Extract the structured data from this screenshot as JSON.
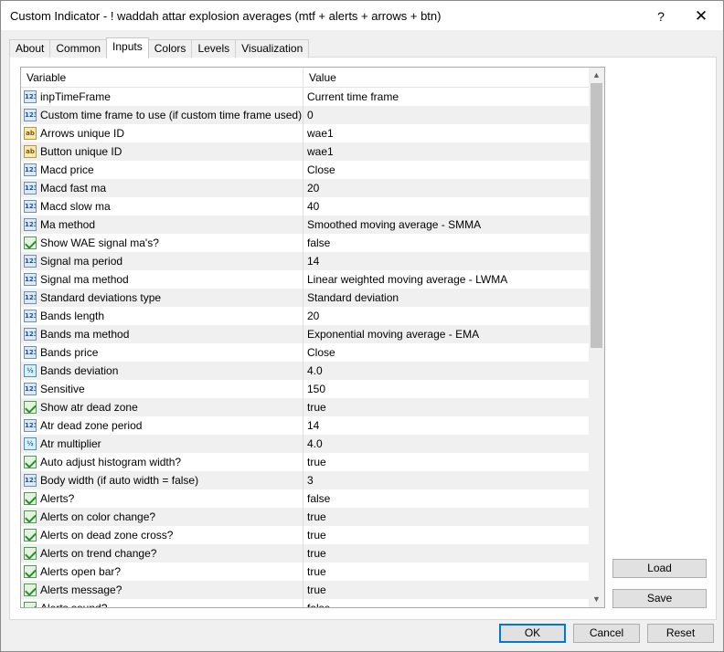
{
  "window": {
    "title": "Custom Indicator - ! waddah attar explosion averages (mtf + alerts + arrows + btn)",
    "help_label": "?",
    "close_label": "✕"
  },
  "tabs": [
    {
      "label": "About",
      "active": false
    },
    {
      "label": "Common",
      "active": false
    },
    {
      "label": "Inputs",
      "active": true
    },
    {
      "label": "Colors",
      "active": false
    },
    {
      "label": "Levels",
      "active": false
    },
    {
      "label": "Visualization",
      "active": false
    }
  ],
  "grid": {
    "columns": {
      "variable": "Variable",
      "value": "Value"
    },
    "rows": [
      {
        "type": "int",
        "icon": "123",
        "variable": "inpTimeFrame",
        "value": "Current time frame"
      },
      {
        "type": "int",
        "icon": "123",
        "variable": "Custom time frame to use (if custom time frame used)",
        "value": "0"
      },
      {
        "type": "str",
        "icon": "ab",
        "variable": "Arrows unique ID",
        "value": "wae1"
      },
      {
        "type": "str",
        "icon": "ab",
        "variable": "Button unique ID",
        "value": "wae1"
      },
      {
        "type": "int",
        "icon": "123",
        "variable": "Macd price",
        "value": "Close"
      },
      {
        "type": "int",
        "icon": "123",
        "variable": "Macd fast ma",
        "value": "20"
      },
      {
        "type": "int",
        "icon": "123",
        "variable": "Macd slow ma",
        "value": "40"
      },
      {
        "type": "int",
        "icon": "123",
        "variable": "Ma method",
        "value": "Smoothed moving average - SMMA"
      },
      {
        "type": "bool",
        "icon": "",
        "variable": "Show WAE signal ma's?",
        "value": "false"
      },
      {
        "type": "int",
        "icon": "123",
        "variable": "Signal ma period",
        "value": "14"
      },
      {
        "type": "int",
        "icon": "123",
        "variable": "Signal ma method",
        "value": "Linear weighted moving average - LWMA"
      },
      {
        "type": "int",
        "icon": "123",
        "variable": "Standard deviations type",
        "value": "Standard deviation"
      },
      {
        "type": "int",
        "icon": "123",
        "variable": "Bands length",
        "value": "20"
      },
      {
        "type": "int",
        "icon": "123",
        "variable": "Bands ma method",
        "value": "Exponential moving average - EMA"
      },
      {
        "type": "int",
        "icon": "123",
        "variable": "Bands price",
        "value": "Close"
      },
      {
        "type": "dbl",
        "icon": "½",
        "variable": "Bands deviation",
        "value": "4.0"
      },
      {
        "type": "int",
        "icon": "123",
        "variable": "Sensitive",
        "value": "150"
      },
      {
        "type": "bool",
        "icon": "",
        "variable": "Show atr dead zone",
        "value": "true"
      },
      {
        "type": "int",
        "icon": "123",
        "variable": "Atr dead zone period",
        "value": "14"
      },
      {
        "type": "dbl",
        "icon": "½",
        "variable": "Atr multiplier",
        "value": "4.0"
      },
      {
        "type": "bool",
        "icon": "",
        "variable": "Auto adjust histogram width?",
        "value": "true"
      },
      {
        "type": "int",
        "icon": "123",
        "variable": "Body width (if auto width = false)",
        "value": "3"
      },
      {
        "type": "bool",
        "icon": "",
        "variable": "Alerts?",
        "value": "false"
      },
      {
        "type": "bool",
        "icon": "",
        "variable": "Alerts on color change?",
        "value": "true"
      },
      {
        "type": "bool",
        "icon": "",
        "variable": "Alerts on dead zone cross?",
        "value": "true"
      },
      {
        "type": "bool",
        "icon": "",
        "variable": "Alerts on trend change?",
        "value": "true"
      },
      {
        "type": "bool",
        "icon": "",
        "variable": "Alerts open bar?",
        "value": "true"
      },
      {
        "type": "bool",
        "icon": "",
        "variable": "Alerts message?",
        "value": "true"
      },
      {
        "type": "bool",
        "icon": "",
        "variable": "Alerts sound?",
        "value": "false"
      }
    ]
  },
  "buttons": {
    "load": "Load",
    "save": "Save",
    "ok": "OK",
    "cancel": "Cancel",
    "reset": "Reset"
  },
  "scrollbar": {
    "up_icon": "▲",
    "down_icon": "▼"
  }
}
